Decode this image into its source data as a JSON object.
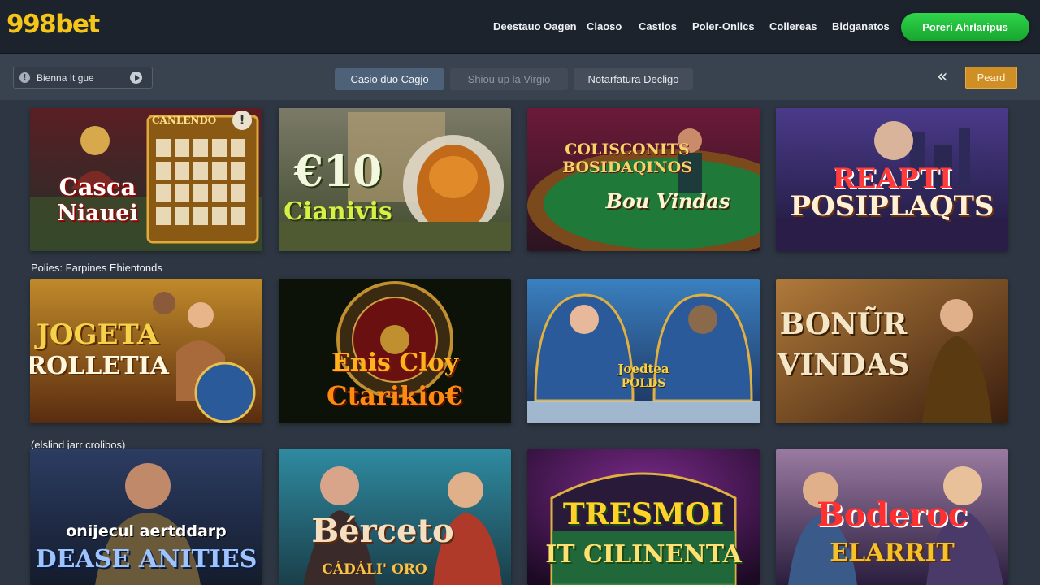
{
  "brand": {
    "logo": "998bet"
  },
  "nav": {
    "items": [
      {
        "label": "Deestauo Oagen"
      },
      {
        "label": "Ciaoso"
      },
      {
        "label": "Castios"
      },
      {
        "label": "Poler-Onlics"
      },
      {
        "label": "Collereas"
      },
      {
        "label": "Bidganatos"
      }
    ],
    "cta_label": "Poreri Ahrlaripus"
  },
  "toolbar": {
    "search_value": "Bienna It gue",
    "tabs": [
      {
        "label": "Casio duo Cagjo",
        "active": true
      },
      {
        "label": "Shiou up la Virgio",
        "active": false
      },
      {
        "label": "Notarfatura Decligo",
        "active": false
      }
    ],
    "back_icon": "double-chevron-left-icon",
    "pearl_label": "Peard"
  },
  "sections": [
    {
      "label": ""
    },
    {
      "label": "Polies: Farpines Ehientonds"
    },
    {
      "label": "(elslind jarr crolibos)"
    }
  ],
  "games": [
    {
      "title_line1": "Casca",
      "title_line2": "Niauei",
      "badge": "CANLENDO",
      "colors": [
        "#7a1c1c",
        "#2b3a3f"
      ]
    },
    {
      "title_line1": "€10",
      "title_line2": "Cianivis",
      "badge": "",
      "colors": [
        "#6b6b55",
        "#3d4a2c"
      ]
    },
    {
      "title_line1": "COLISCONITS",
      "title_line2": "BOSIDAQINOS",
      "subtitle": "Bou Vindas",
      "badge": "",
      "colors": [
        "#5c1830",
        "#1f4d2e"
      ]
    },
    {
      "title_line1": "REAPTI",
      "title_line2": "POSIPLAQTS",
      "badge": "",
      "colors": [
        "#3b2a6e",
        "#1f1a3e"
      ]
    },
    {
      "title_line1": "JOGETA",
      "title_line2": "ROLLETIA",
      "badge": "",
      "colors": [
        "#a46a1e",
        "#5a2c10"
      ]
    },
    {
      "title_line1": "Enis Cloy",
      "title_line2": "Ctarikio€",
      "badge": "",
      "colors": [
        "#2e4a12",
        "#0d1408"
      ]
    },
    {
      "title_line1": "Joedtea",
      "title_line2": "POLDS",
      "badge": "",
      "colors": [
        "#2f6aa0",
        "#1b2d55"
      ]
    },
    {
      "title_line1": "BONŨR",
      "title_line2": "VINDAS",
      "badge": "",
      "colors": [
        "#7a4a22",
        "#3a2010"
      ]
    },
    {
      "title_line1": "onijecul aertddarp",
      "title_line2": "DEASE ANITIES",
      "badge": "",
      "colors": [
        "#3a4e70",
        "#1a2336"
      ]
    },
    {
      "title_line1": "Bérceto",
      "title_line2": "CÁDÁLI' ORO",
      "badge": "",
      "colors": [
        "#2e7c8e",
        "#18404c"
      ]
    },
    {
      "title_line1": "TRESMOI",
      "title_line2": "IT CILINENTA",
      "badge": "",
      "colors": [
        "#5a1e6e",
        "#2a0d36"
      ]
    },
    {
      "title_line1": "Boderoc",
      "title_line2": "ELARRIT",
      "badge": "",
      "colors": [
        "#8c6a8a",
        "#3c2a4c"
      ]
    }
  ]
}
